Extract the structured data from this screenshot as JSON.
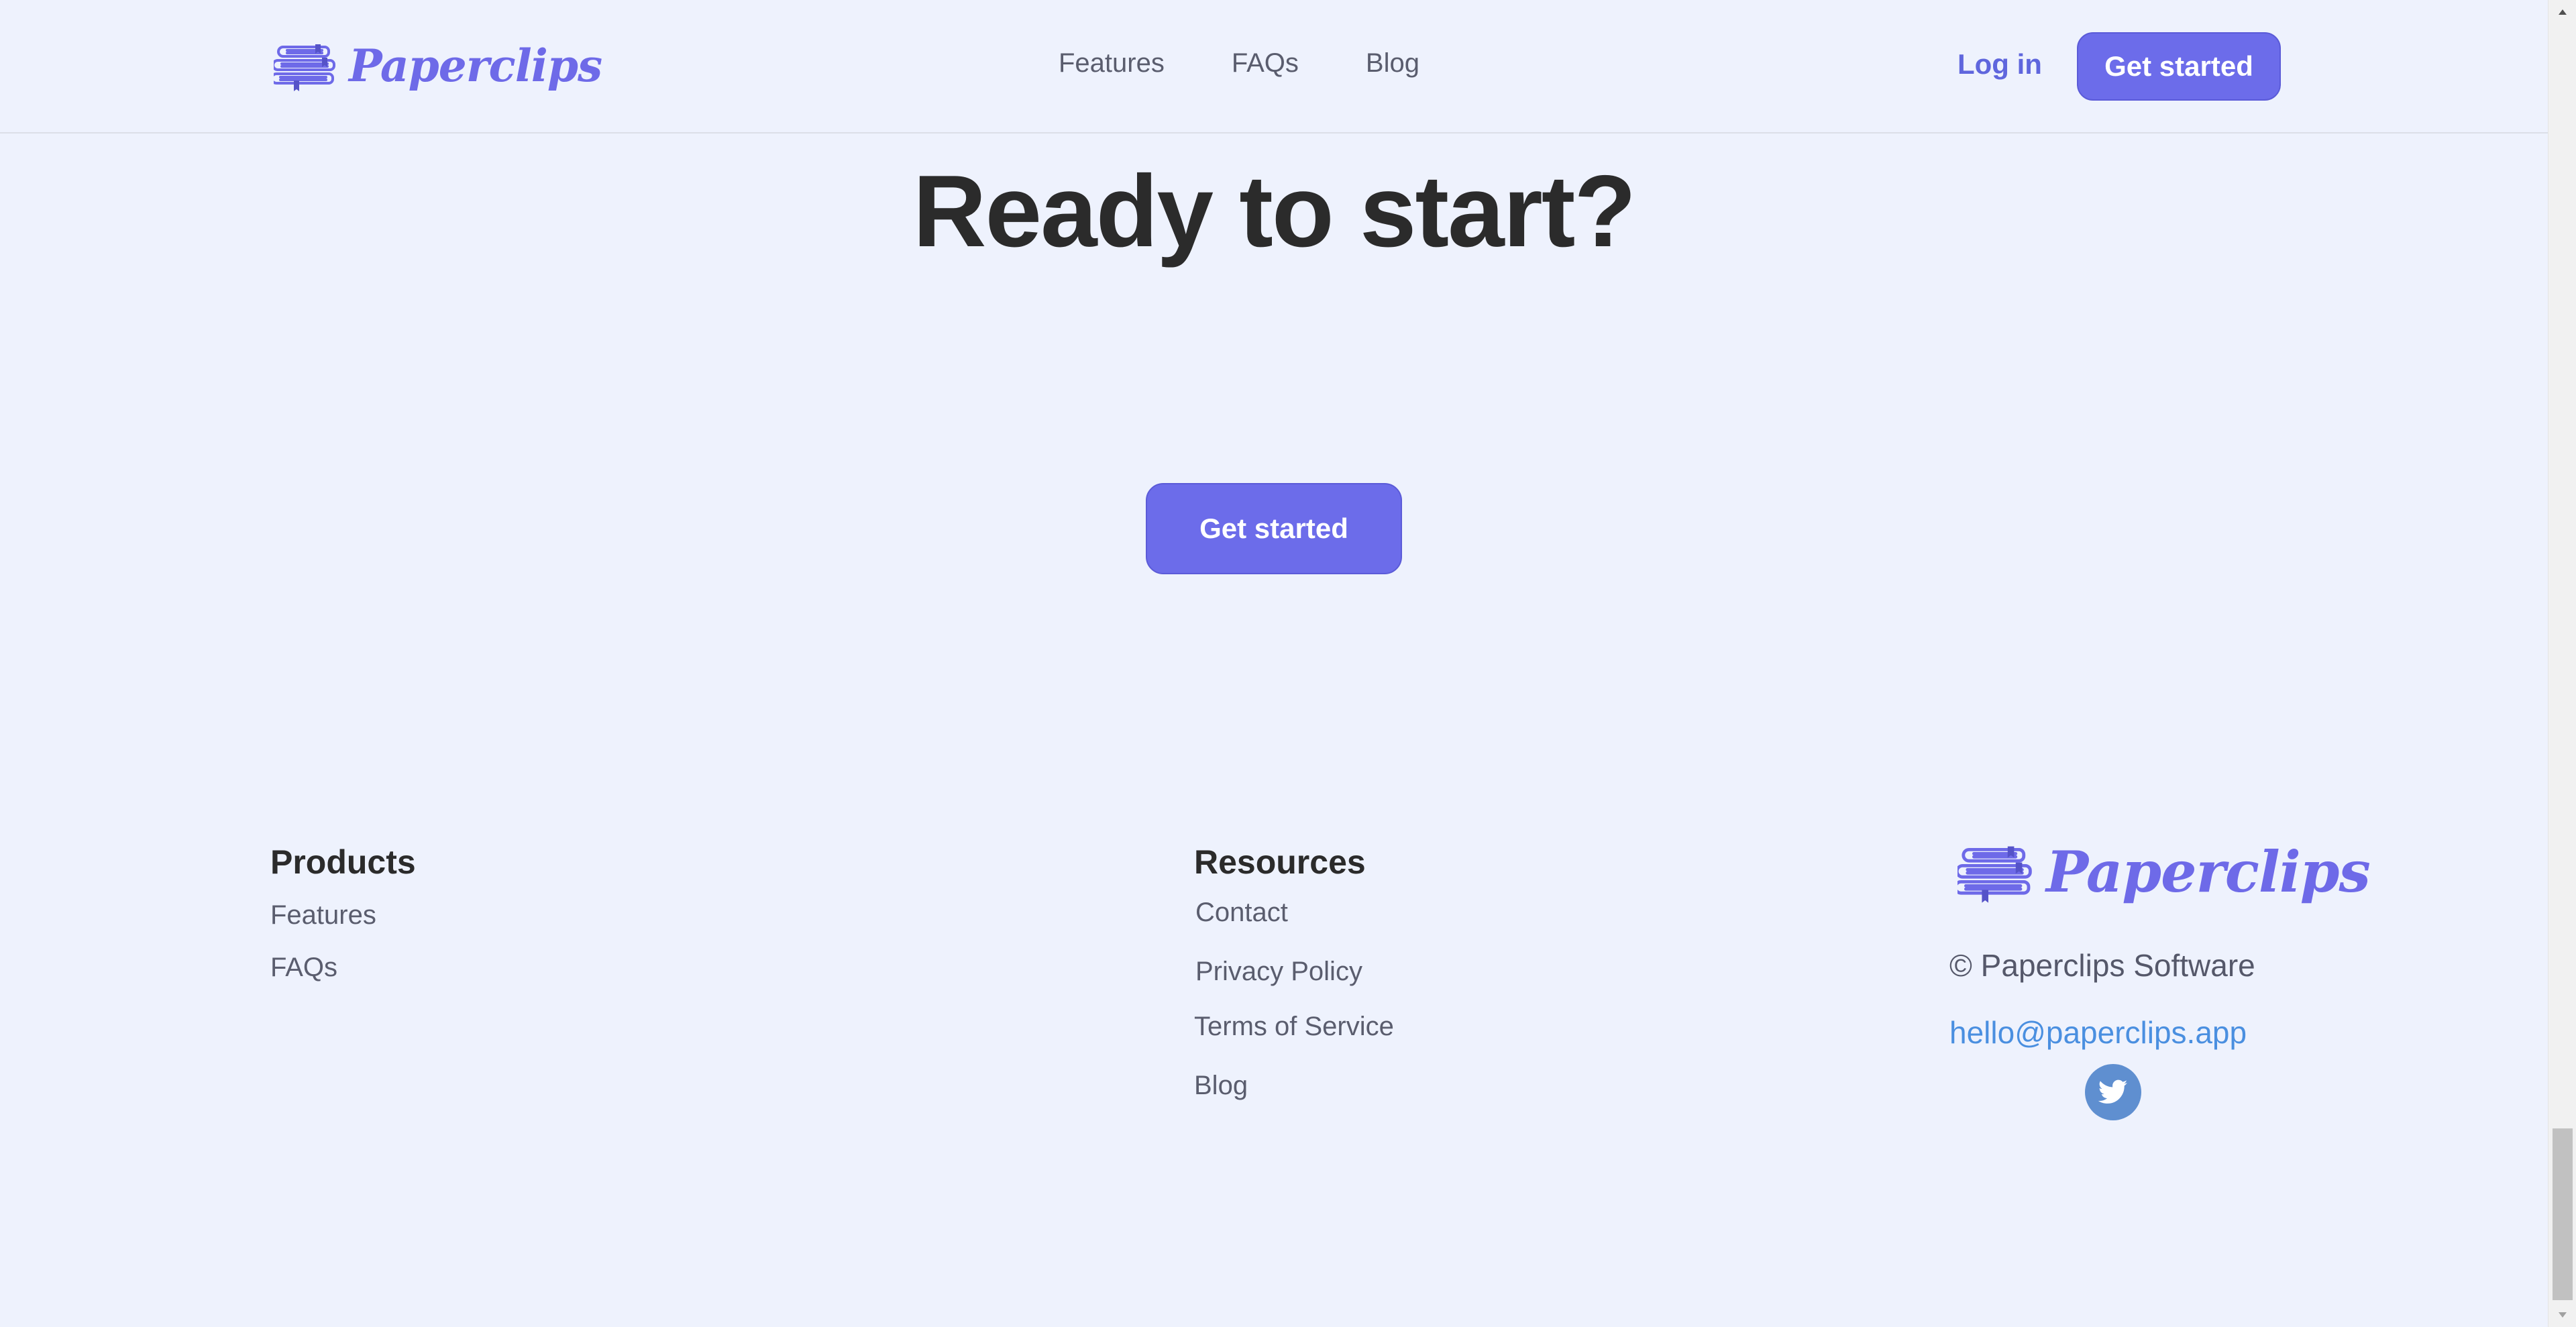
{
  "header": {
    "brand": "Paperclips",
    "nav": [
      {
        "label": "Features"
      },
      {
        "label": "FAQs"
      },
      {
        "label": "Blog"
      }
    ],
    "login_label": "Log in",
    "cta_label": "Get started"
  },
  "hero": {
    "title": "Ready to start?",
    "cta_label": "Get started"
  },
  "footer": {
    "products": {
      "title": "Products",
      "links": [
        "Features",
        "FAQs"
      ]
    },
    "resources": {
      "title": "Resources",
      "links": [
        "Contact",
        "Privacy Policy",
        "Terms of Service",
        "Blog"
      ]
    },
    "brand": "Paperclips",
    "copyright": "© Paperclips Software",
    "email": "hello@paperclips.app",
    "social_icon": "twitter-icon"
  },
  "colors": {
    "background": "#eef2fd",
    "accent": "#6c6cea",
    "link": "#4a8fe0",
    "twitter": "#5f8fd0"
  }
}
